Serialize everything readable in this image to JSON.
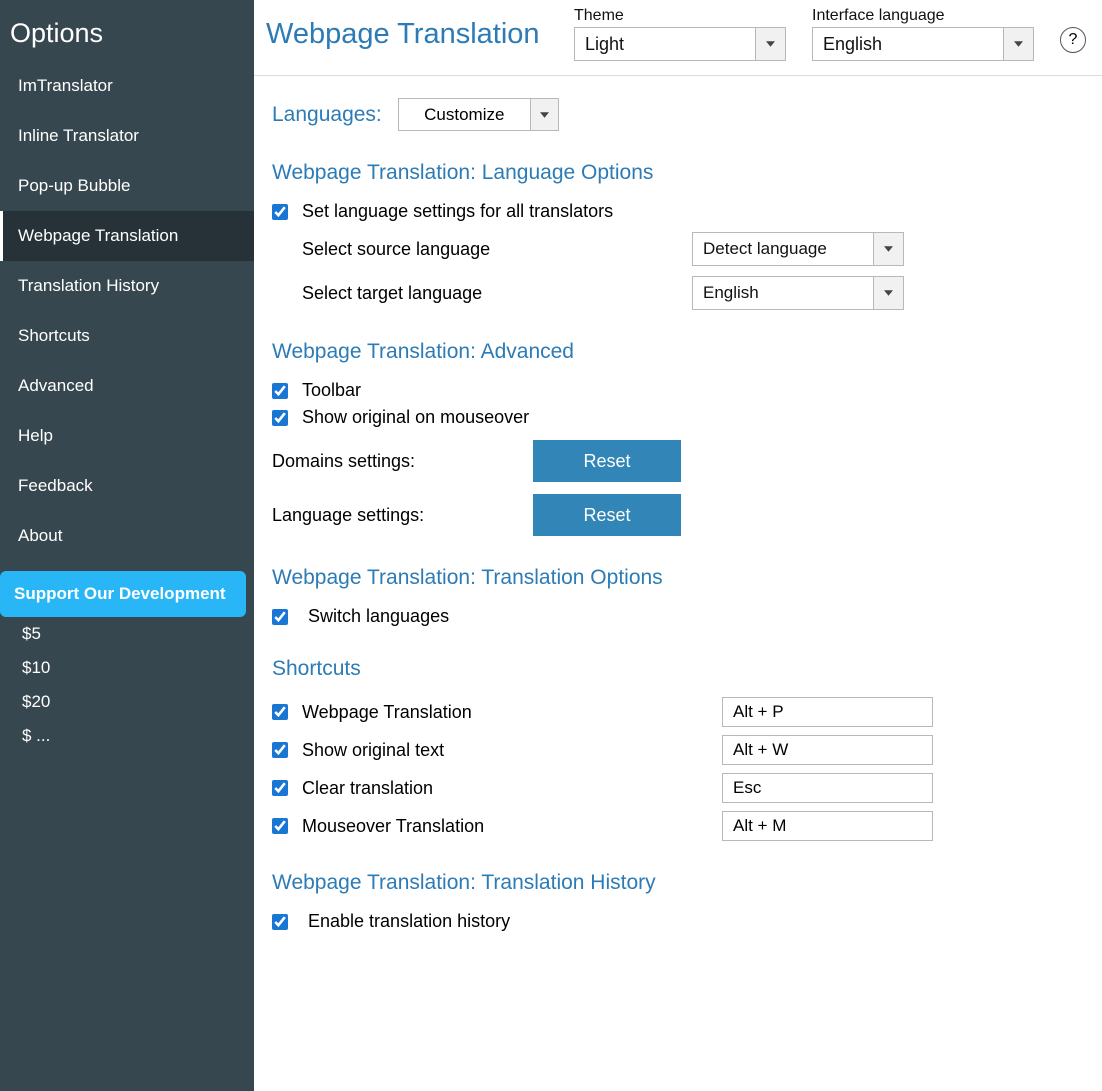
{
  "sidebar": {
    "title": "Options",
    "items": [
      {
        "label": "ImTranslator"
      },
      {
        "label": "Inline Translator"
      },
      {
        "label": "Pop-up Bubble"
      },
      {
        "label": "Webpage Translation"
      },
      {
        "label": "Translation History"
      },
      {
        "label": "Shortcuts"
      },
      {
        "label": "Advanced"
      },
      {
        "label": "Help"
      },
      {
        "label": "Feedback"
      },
      {
        "label": "About"
      }
    ],
    "support_label": "Support Our Development",
    "donate": [
      "$5",
      "$10",
      "$20",
      "$ ..."
    ]
  },
  "header": {
    "page_title": "Webpage Translation",
    "theme_label": "Theme",
    "theme_value": "Light",
    "iface_label": "Interface language",
    "iface_value": "English"
  },
  "languages": {
    "label": "Languages:",
    "button": "Customize"
  },
  "section_lang": {
    "title": "Webpage Translation: Language Options",
    "set_all": "Set language settings for all translators",
    "source_label": "Select source language",
    "source_value": "Detect language",
    "target_label": "Select target language",
    "target_value": "English"
  },
  "section_adv": {
    "title": "Webpage Translation: Advanced",
    "toolbar": "Toolbar",
    "mouseover": "Show original on mouseover",
    "domains_label": "Domains settings:",
    "lang_label": "Language settings:",
    "reset": "Reset"
  },
  "section_trans": {
    "title": "Webpage Translation: Translation Options",
    "switch": "Switch languages"
  },
  "section_shortcuts": {
    "title": "Shortcuts",
    "rows": [
      {
        "label": "Webpage Translation",
        "key": "Alt + P"
      },
      {
        "label": "Show original text",
        "key": "Alt + W"
      },
      {
        "label": "Clear translation",
        "key": "Esc"
      },
      {
        "label": "Mouseover Translation",
        "key": "Alt + M"
      }
    ]
  },
  "section_hist": {
    "title": "Webpage Translation: Translation History",
    "enable": "Enable translation history"
  }
}
